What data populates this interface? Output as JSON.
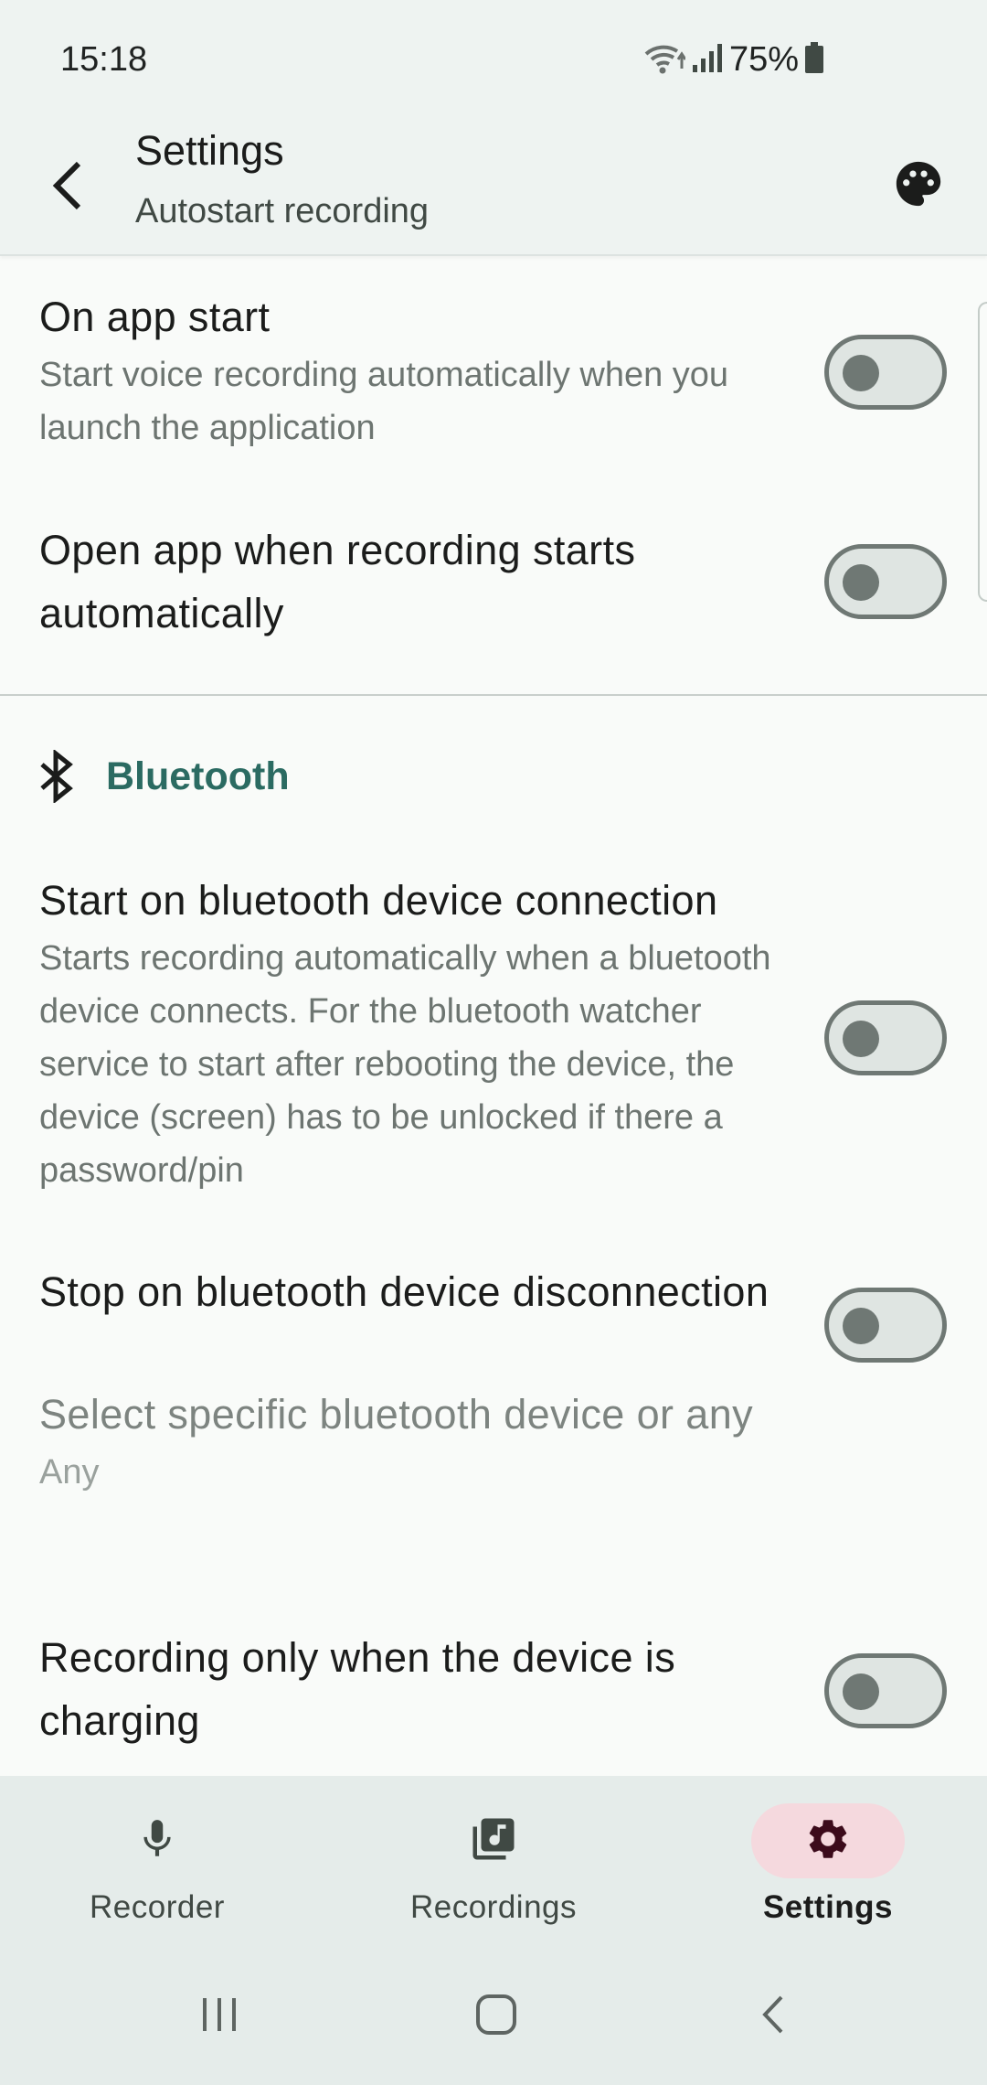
{
  "status_bar": {
    "time": "15:18",
    "battery": "75%",
    "icons": [
      "wifi-icon",
      "signal-icon",
      "battery-icon"
    ]
  },
  "app_bar": {
    "title": "Settings",
    "subtitle": "Autostart recording",
    "back_icon": "arrow-back-icon",
    "action_icon": "palette-icon"
  },
  "preferences": [
    {
      "title": "On app start",
      "summary": "Start voice recording automatically when you launch the application",
      "checked": false
    },
    {
      "title": "Open app when recording starts automatically",
      "checked": false
    }
  ],
  "bluetooth": {
    "category_title": "Bluetooth",
    "icon": "bluetooth-icon",
    "items": [
      {
        "title": "Start on bluetooth device connection",
        "summary": "Starts recording automatically when a bluetooth device connects. For the bluetooth watcher service to start after rebooting the device, the device (screen) has to be unlocked if there a password/pin",
        "checked": false
      },
      {
        "title": "Stop on bluetooth device disconnection",
        "checked": false
      },
      {
        "title": "Select specific bluetooth device or any",
        "value": "Any",
        "enabled": false
      },
      {
        "title": "Recording only when the device is charging",
        "checked": false
      }
    ]
  },
  "bottom_nav": {
    "items": [
      {
        "label": "Recorder",
        "icon": "microphone-icon",
        "active": false
      },
      {
        "label": "Recordings",
        "icon": "library-music-icon",
        "active": false
      },
      {
        "label": "Settings",
        "icon": "gear-icon",
        "active": true
      }
    ]
  },
  "system_nav": {
    "icons": [
      "recents-icon",
      "home-icon",
      "back-icon"
    ]
  },
  "colors": {
    "accent": "#2b6b62",
    "background": "#f9fbf9",
    "bar_background": "#eef3f1",
    "nav_active_pill": "#f5d9de",
    "switch_off": "#6f7874"
  }
}
